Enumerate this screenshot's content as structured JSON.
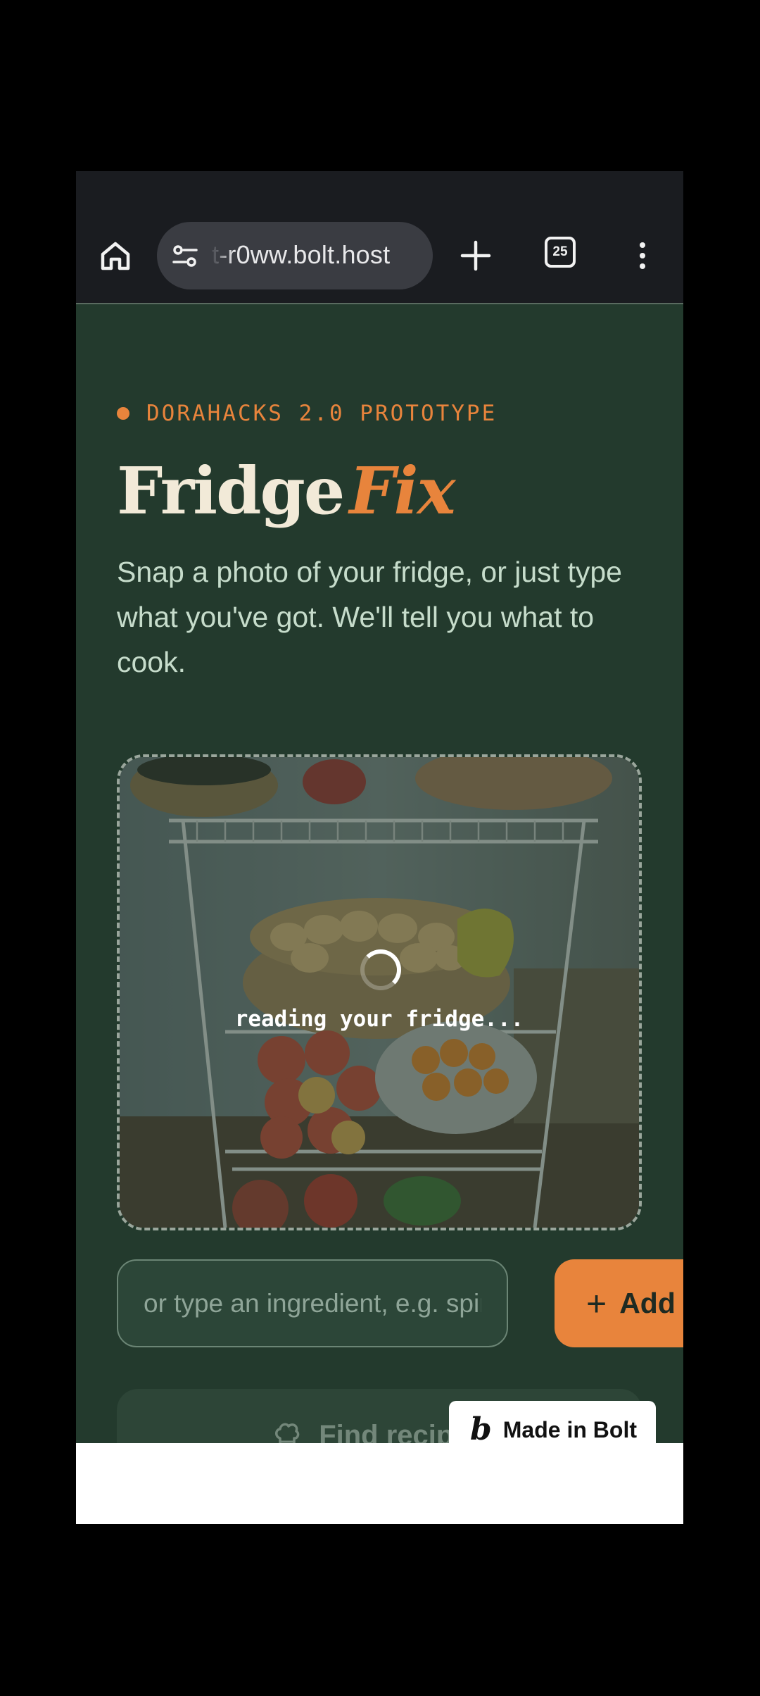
{
  "browser": {
    "url": "-r0ww.bolt.host",
    "url_partial_prefix": "t",
    "tab_count": "25",
    "icons": [
      "home-icon",
      "site-settings-icon",
      "plus-icon",
      "tabs-icon",
      "more-vert-icon"
    ]
  },
  "page": {
    "kicker": "DORAHACKS 2.0 PROTOTYPE",
    "title": "Fridge",
    "title_accent": "Fix",
    "subtitle": "Snap a photo of your fridge, or just type what you've got. We'll tell you what to cook.",
    "photo": {
      "status_text": "reading your fridge..."
    },
    "ingredient_input": {
      "placeholder": "or type an ingredient, e.g. spinach"
    },
    "add_button": "Add",
    "find_button": "Find recipes",
    "badge": "Made in Bolt",
    "badge_logo": "b"
  },
  "colors": {
    "background": "#233a2d",
    "accent": "#e8843c",
    "title": "#f2ead8",
    "subtitle": "#c6dccb"
  }
}
